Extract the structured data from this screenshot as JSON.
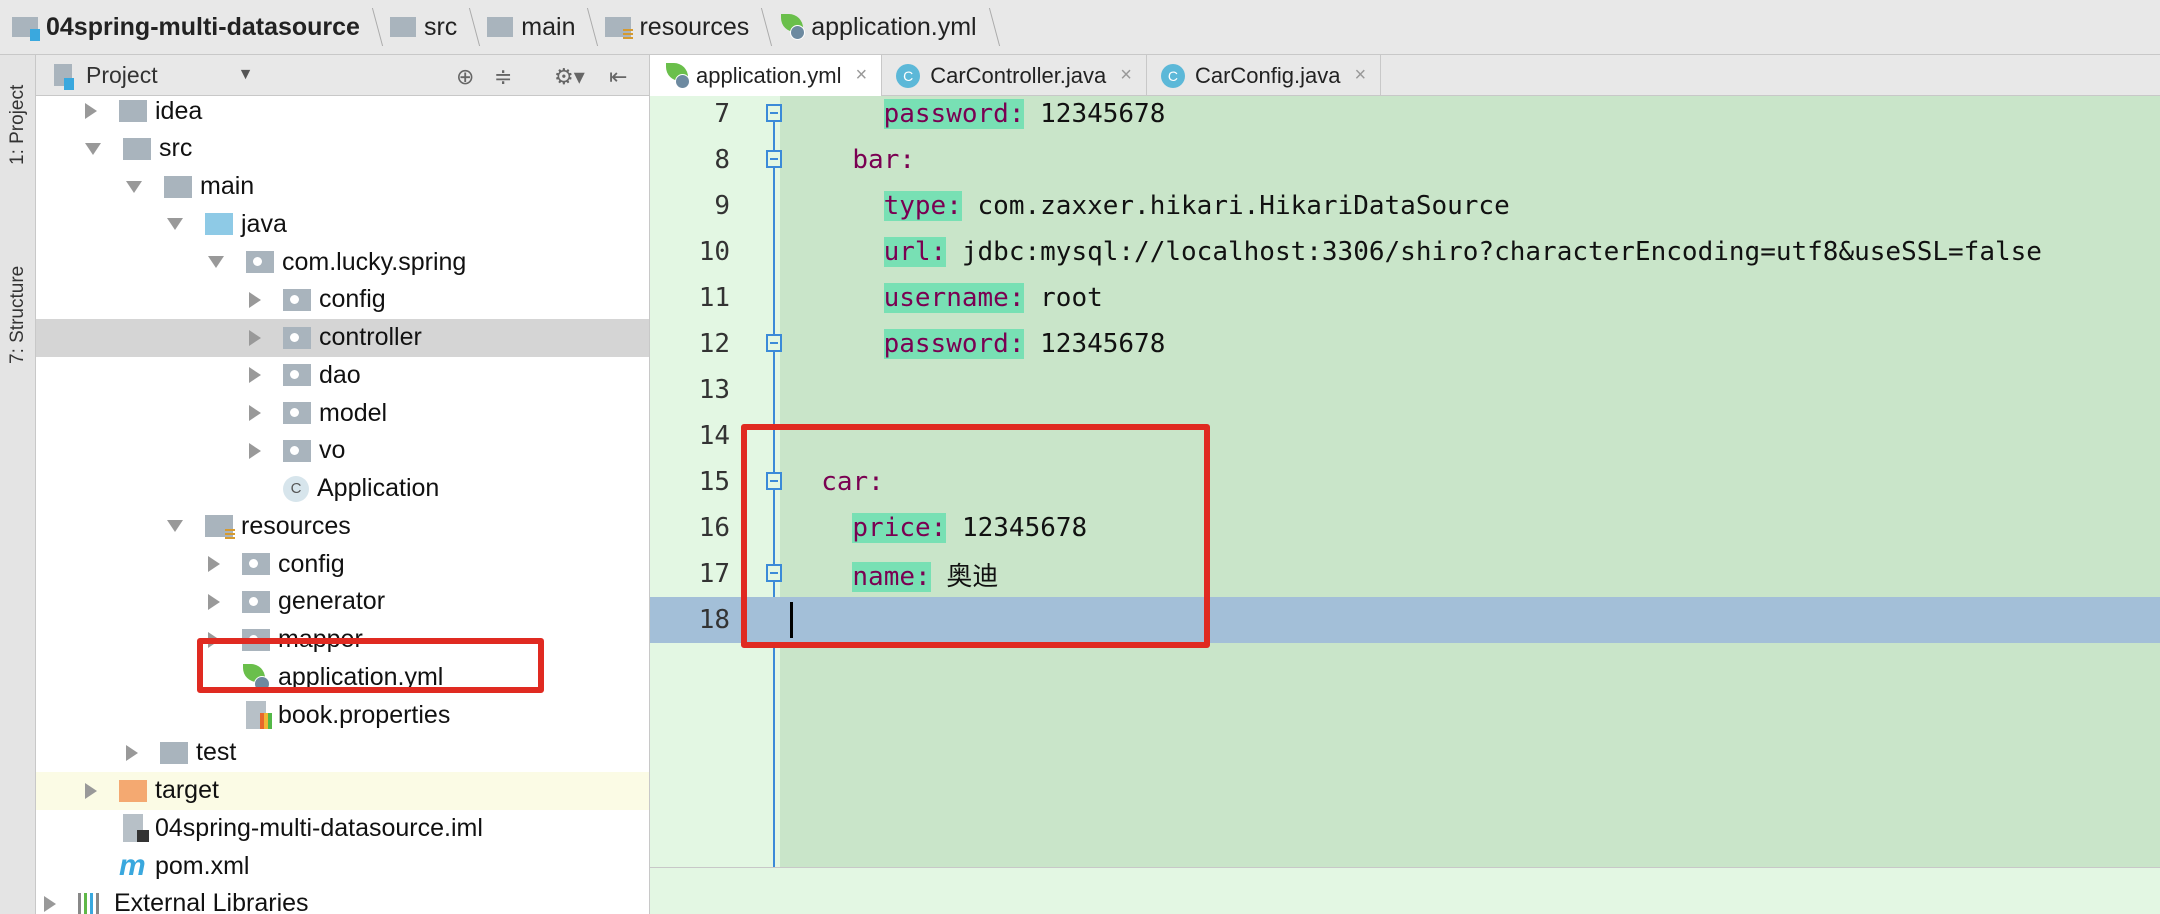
{
  "breadcrumb": [
    {
      "label": "04spring-multi-datasource",
      "icon": "module-folder-icon"
    },
    {
      "label": "src",
      "icon": "folder-icon"
    },
    {
      "label": "main",
      "icon": "folder-icon"
    },
    {
      "label": "resources",
      "icon": "resources-folder-icon"
    },
    {
      "label": "application.yml",
      "icon": "spring-yml-icon"
    }
  ],
  "toolstrip": {
    "project": "1: Project",
    "structure": "7: Structure"
  },
  "project_panel": {
    "title": "Project",
    "dropdown": "▼",
    "icons": [
      "locate-icon",
      "collapse-icon",
      "gear-icon",
      "hide-icon"
    ]
  },
  "tree": [
    {
      "label": "idea",
      "level": 1,
      "arrow": "closed",
      "icon": "folder"
    },
    {
      "label": "src",
      "level": 1,
      "arrow": "open",
      "icon": "folder"
    },
    {
      "label": "main",
      "level": 2,
      "arrow": "open",
      "icon": "folder"
    },
    {
      "label": "java",
      "level": 3,
      "arrow": "open",
      "icon": "srcf"
    },
    {
      "label": "com.lucky.spring",
      "level": 4,
      "arrow": "open",
      "icon": "pkg"
    },
    {
      "label": "config",
      "level": 5,
      "arrow": "closed",
      "icon": "pkg"
    },
    {
      "label": "controller",
      "level": 5,
      "arrow": "closed",
      "icon": "pkg",
      "selected": true
    },
    {
      "label": "dao",
      "level": 5,
      "arrow": "closed",
      "icon": "pkg"
    },
    {
      "label": "model",
      "level": 5,
      "arrow": "closed",
      "icon": "pkg"
    },
    {
      "label": "vo",
      "level": 5,
      "arrow": "closed",
      "icon": "pkg"
    },
    {
      "label": "Application",
      "level": 5,
      "arrow": "none",
      "icon": "app"
    },
    {
      "label": "resources",
      "level": 3,
      "arrow": "open",
      "icon": "resf"
    },
    {
      "label": "config",
      "level": 4,
      "arrow": "closed",
      "icon": "pkg"
    },
    {
      "label": "generator",
      "level": 4,
      "arrow": "closed",
      "icon": "pkg"
    },
    {
      "label": "mapper",
      "level": 4,
      "arrow": "closed",
      "icon": "pkg"
    },
    {
      "label": "application.yml",
      "level": 4,
      "arrow": "none",
      "icon": "yml"
    },
    {
      "label": "book.properties",
      "level": 4,
      "arrow": "none",
      "icon": "file props"
    },
    {
      "label": "test",
      "level": 2,
      "arrow": "closed",
      "icon": "folder"
    },
    {
      "label": "target",
      "level": 1,
      "arrow": "closed",
      "icon": "target",
      "highlighted": true
    },
    {
      "label": "04spring-multi-datasource.iml",
      "level": 1,
      "arrow": "none",
      "icon": "file iml"
    },
    {
      "label": "pom.xml",
      "level": 1,
      "arrow": "none",
      "icon": "maven"
    },
    {
      "label": "External Libraries",
      "level": 0,
      "arrow": "closed",
      "icon": "libs"
    }
  ],
  "tabs": [
    {
      "label": "application.yml",
      "icon": "spring-yml-icon",
      "active": true,
      "close": "×"
    },
    {
      "label": "CarController.java",
      "icon": "class-icon",
      "close": "×"
    },
    {
      "label": "CarConfig.java",
      "icon": "class-icon",
      "close": "×"
    }
  ],
  "class_icon_letter": "C",
  "code": [
    {
      "n": "7",
      "indent": 3,
      "key": "password:",
      "value": " 12345678",
      "fold": "end"
    },
    {
      "n": "8",
      "indent": 2,
      "key": "bar:",
      "plain": true,
      "fold": "start"
    },
    {
      "n": "9",
      "indent": 3,
      "key": "type:",
      "value": " com.zaxxer.hikari.HikariDataSource"
    },
    {
      "n": "10",
      "indent": 3,
      "key": "url:",
      "value": " jdbc:mysql://localhost:3306/shiro?characterEncoding=utf8&useSSL=false"
    },
    {
      "n": "11",
      "indent": 3,
      "key": "username:",
      "value": " root"
    },
    {
      "n": "12",
      "indent": 3,
      "key": "password:",
      "value": " 12345678",
      "fold": "end"
    },
    {
      "n": "13",
      "indent": 0
    },
    {
      "n": "14",
      "indent": 0
    },
    {
      "n": "15",
      "indent": 1,
      "key": "car:",
      "plain": true,
      "fold": "start"
    },
    {
      "n": "16",
      "indent": 2,
      "key": "price:",
      "value": " 12345678"
    },
    {
      "n": "17",
      "indent": 2,
      "key": "name:",
      "value": " 奥迪",
      "fold": "end"
    },
    {
      "n": "18",
      "indent": 0,
      "current": true
    }
  ],
  "colors": {
    "annotation_box": "#e02a21",
    "editor_bg": "#c9e5c9",
    "current_line": "#a3bfd8",
    "key": "#7a0052",
    "key_highlight": "#78e0b4"
  }
}
